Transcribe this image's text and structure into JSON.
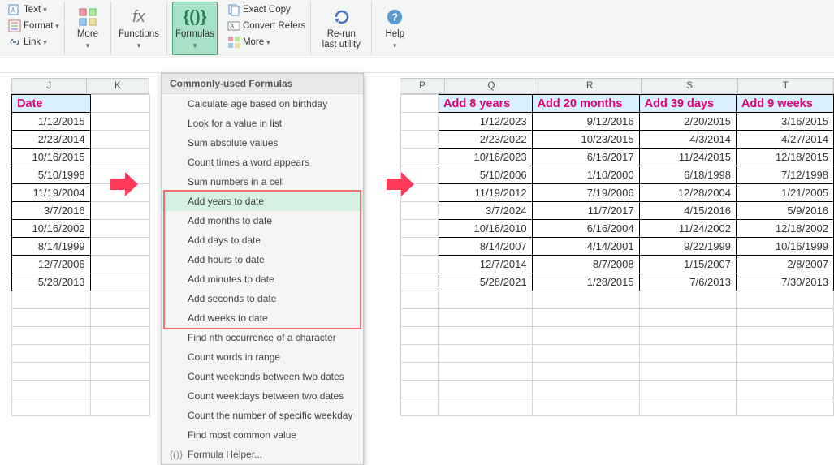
{
  "ribbon": {
    "text_label": "Text",
    "format_label": "Format",
    "link_label": "Link",
    "more1_label": "More",
    "functions_label": "Functions",
    "formulas_label": "Formulas",
    "exact_copy_label": "Exact Copy",
    "convert_refers_label": "Convert Refers",
    "more2_label": "More",
    "rerun_label": "Re-run\nlast utility",
    "help_label": "Help"
  },
  "menu": {
    "title": "Commonly-used Formulas",
    "items": [
      "Calculate age based on birthday",
      "Look for a value in list",
      "Sum absolute values",
      "Count times a word appears",
      "Sum numbers in a cell",
      "Add years to date",
      "Add months to date",
      "Add days to date",
      "Add hours to date",
      "Add minutes to date",
      "Add seconds to date",
      "Add weeks to date",
      "Find nth occurrence of a character",
      "Count words in range",
      "Count weekends between two dates",
      "Count weekdays between two dates",
      "Count the number of specific weekday",
      "Find most common value"
    ],
    "helper": "Formula Helper..."
  },
  "columns_left": [
    "J",
    "K"
  ],
  "columns_right": [
    "P",
    "Q",
    "R",
    "S",
    "T"
  ],
  "left_header": "Date",
  "right_headers": [
    "Add 8 years",
    "Add 20 months",
    "Add 39 days",
    "Add 9 weeks"
  ],
  "left_data": [
    "1/12/2015",
    "2/23/2014",
    "10/16/2015",
    "5/10/1998",
    "11/19/2004",
    "3/7/2016",
    "10/16/2002",
    "8/14/1999",
    "12/7/2006",
    "5/28/2013"
  ],
  "right_data": [
    [
      "1/12/2023",
      "9/12/2016",
      "2/20/2015",
      "3/16/2015"
    ],
    [
      "2/23/2022",
      "10/23/2015",
      "4/3/2014",
      "4/27/2014"
    ],
    [
      "10/16/2023",
      "6/16/2017",
      "11/24/2015",
      "12/18/2015"
    ],
    [
      "5/10/2006",
      "1/10/2000",
      "6/18/1998",
      "7/12/1998"
    ],
    [
      "11/19/2012",
      "7/19/2006",
      "12/28/2004",
      "1/21/2005"
    ],
    [
      "3/7/2024",
      "11/7/2017",
      "4/15/2016",
      "5/9/2016"
    ],
    [
      "10/16/2010",
      "6/16/2004",
      "11/24/2002",
      "12/18/2002"
    ],
    [
      "8/14/2007",
      "4/14/2001",
      "9/22/1999",
      "10/16/1999"
    ],
    [
      "12/7/2014",
      "8/7/2008",
      "1/15/2007",
      "2/8/2007"
    ],
    [
      "5/28/2021",
      "1/28/2015",
      "7/6/2013",
      "7/30/2013"
    ]
  ],
  "col_widths": {
    "J": 100,
    "K": 84,
    "gap": 334,
    "P": 60,
    "Q": 124,
    "R": 138,
    "S": 128,
    "T": 128
  }
}
